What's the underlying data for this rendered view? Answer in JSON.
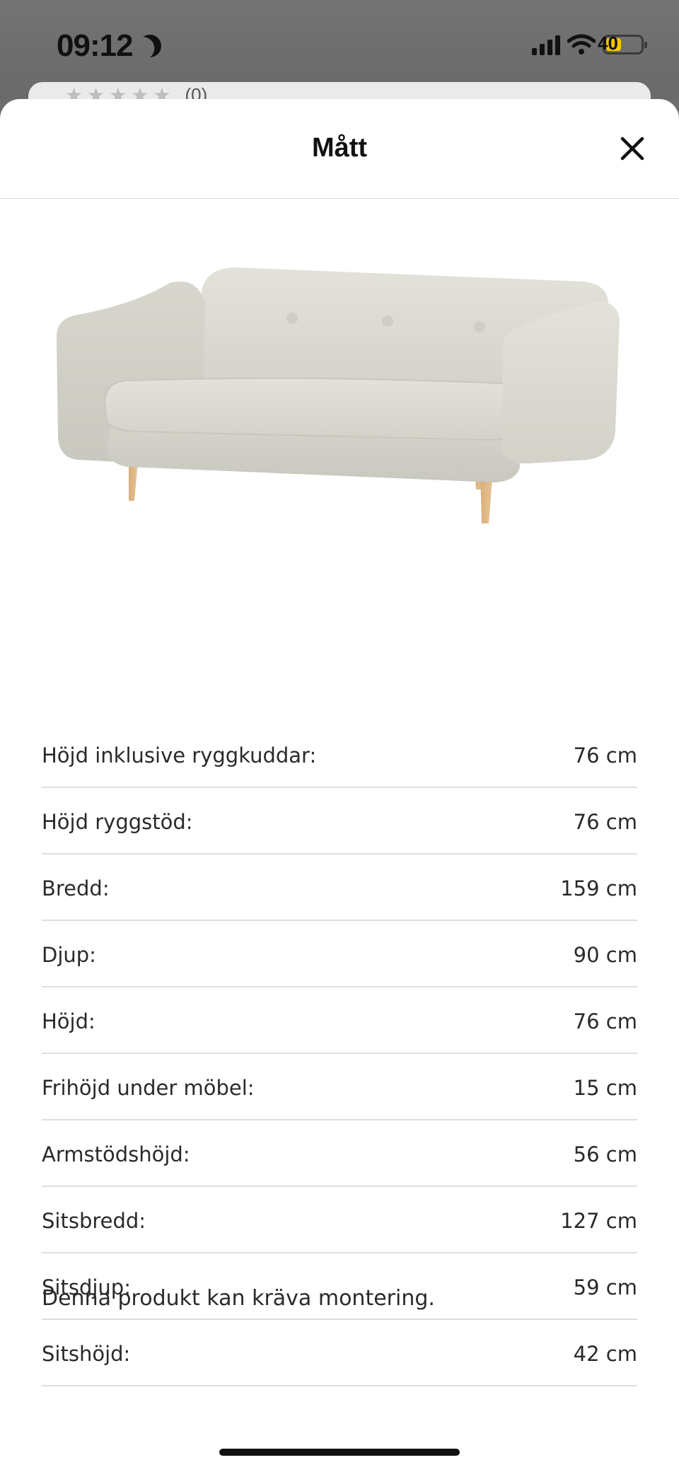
{
  "status_bar": {
    "time": "09:12",
    "battery_text": "40",
    "battery_level": 0.4,
    "battery_color": "#f7c500"
  },
  "background_card": {
    "rating_count": "(0)"
  },
  "sheet": {
    "title": "Mått",
    "close_icon": "close-icon"
  },
  "product": {
    "image_alt": "sofa"
  },
  "specs": [
    {
      "label": "Höjd inklusive ryggkuddar:",
      "value": "76 cm"
    },
    {
      "label": "Höjd ryggstöd:",
      "value": "76 cm"
    },
    {
      "label": "Bredd:",
      "value": "159 cm"
    },
    {
      "label": "Djup:",
      "value": "90 cm"
    },
    {
      "label": "Höjd:",
      "value": "76 cm"
    },
    {
      "label": "Frihöjd under möbel:",
      "value": "15 cm"
    },
    {
      "label": "Armstödshöjd:",
      "value": "56 cm"
    },
    {
      "label": "Sitsbredd:",
      "value": "127 cm"
    },
    {
      "label": "Sitsdjup:",
      "value": "59 cm"
    },
    {
      "label": "Sitshöjd:",
      "value": "42 cm"
    }
  ],
  "note": "Denna produkt kan kräva montering."
}
